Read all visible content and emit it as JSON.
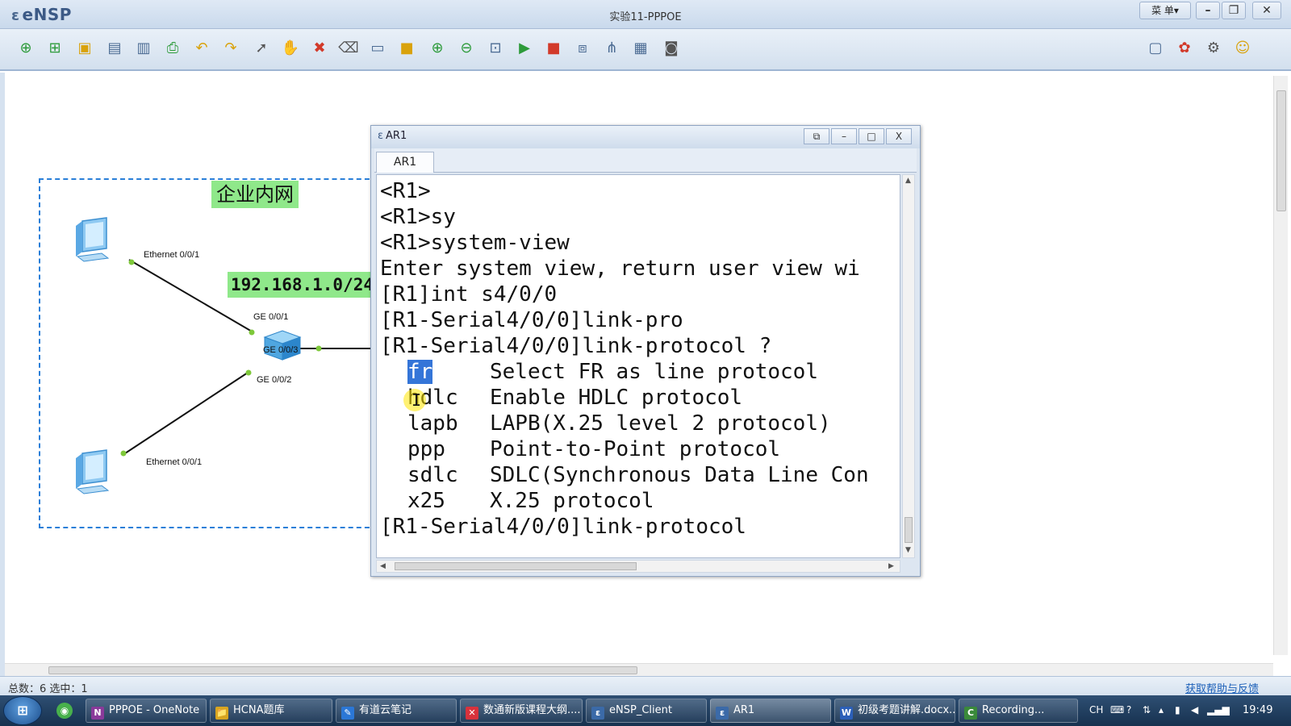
{
  "app": {
    "name": "eNSP",
    "window_title": "实验11-PPPOE",
    "menu_label": "菜 单▾"
  },
  "window_controls": {
    "minimize": "–",
    "restore": "❐",
    "close": "✕"
  },
  "toolbar": {
    "icons": [
      "new-topology",
      "new-lab",
      "open",
      "save",
      "save-as",
      "print",
      "undo",
      "redo",
      "select",
      "pan",
      "delete",
      "delete-link",
      "text-label",
      "rectangle",
      "zoom-in",
      "zoom-out",
      "fit-view",
      "start-device",
      "stop-device",
      "capture",
      "topology",
      "grid",
      "screenshot",
      "chat",
      "huawei",
      "settings",
      "help"
    ]
  },
  "topology": {
    "zone_label": "企业内网",
    "network_label": "192.168.1.0/24",
    "ports": {
      "pc1_eth": "Ethernet 0/0/1",
      "pc2_eth": "Ethernet 0/0/1",
      "sw_ge001": "GE 0/0/1",
      "sw_ge003": "GE 0/0/3",
      "sw_ge002": "GE 0/0/2"
    }
  },
  "ar1": {
    "title": "AR1",
    "tab": "AR1",
    "controls": {
      "clone": "⧉",
      "minimize": "–",
      "maximize": "□",
      "close": "X"
    },
    "console_lines": [
      "<R1>",
      "<R1>sy",
      "<R1>system-view",
      "Enter system view, return user view wi",
      "[R1]int s4/0/0",
      "[R1-Serial4/0/0]link-pro",
      "[R1-Serial4/0/0]link-protocol ?"
    ],
    "options": [
      {
        "name": "fr",
        "desc": "Select FR as line protocol"
      },
      {
        "name": "hdlc",
        "desc": "Enable HDLC protocol"
      },
      {
        "name": "lapb",
        "desc": "LAPB(X.25 level 2 protocol)"
      },
      {
        "name": "ppp",
        "desc": "Point-to-Point protocol"
      },
      {
        "name": "sdlc",
        "desc": "SDLC(Synchronous Data Line Con"
      },
      {
        "name": "x25",
        "desc": "X.25 protocol"
      }
    ],
    "prompt_line": "[R1-Serial4/0/0]link-protocol"
  },
  "status": {
    "text": "总数：6 选中：1",
    "help_link": "获取帮助与反馈"
  },
  "taskbar": {
    "items": [
      {
        "label": "PPPOE - OneNote",
        "icon": "N",
        "color": "#8a3a9a"
      },
      {
        "label": "HCNA题库",
        "icon": "📁",
        "color": "#d9a520"
      },
      {
        "label": "有道云笔记",
        "icon": "✎",
        "color": "#2b77d6"
      },
      {
        "label": "数通新版课程大纲....",
        "icon": "✕",
        "color": "#d8323c"
      },
      {
        "label": "eNSP_Client",
        "icon": "ε",
        "color": "#3b6aa8"
      },
      {
        "label": "AR1",
        "icon": "ε",
        "color": "#3b6aa8"
      },
      {
        "label": "初级考题讲解.docx...",
        "icon": "W",
        "color": "#2b5fb8"
      },
      {
        "label": "Recording...",
        "icon": "C",
        "color": "#3a8a3a"
      }
    ],
    "tray": {
      "lang": "CH",
      "clock": "19:49"
    }
  },
  "colors": {
    "accent": "#2a7fd8",
    "label_green": "#8fe88a",
    "highlight": "#3475d8"
  }
}
